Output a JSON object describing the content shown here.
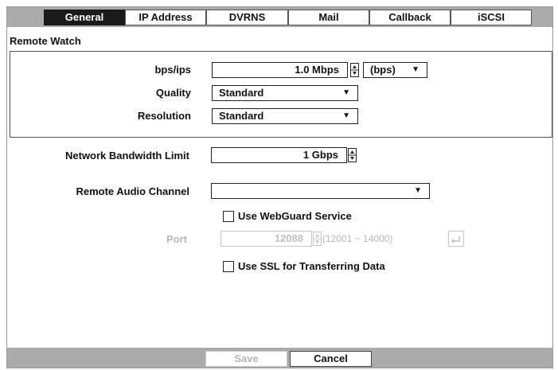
{
  "tabs": [
    "General",
    "IP Address",
    "DVRNS",
    "Mail",
    "Callback",
    "iSCSI"
  ],
  "active_tab": "General",
  "remote_watch": {
    "title": "Remote Watch",
    "bps_label": "bps/ips",
    "bps_value": "1.0 Mbps",
    "unit_value": "(bps)",
    "quality_label": "Quality",
    "quality_value": "Standard",
    "resolution_label": "Resolution",
    "resolution_value": "Standard"
  },
  "network_bandwidth": {
    "label": "Network Bandwidth Limit",
    "value": "1 Gbps"
  },
  "remote_audio": {
    "label": "Remote Audio Channel",
    "value": ""
  },
  "webguard": {
    "label": "Use WebGuard Service",
    "checked": false,
    "port_label": "Port",
    "port_value": "12088",
    "port_range": "(12001 ~ 14000)"
  },
  "ssl": {
    "label": "Use SSL for Transferring Data",
    "checked": false
  },
  "buttons": {
    "save": "Save",
    "cancel": "Cancel"
  },
  "icons": {
    "spin": "spin-arrows-icon",
    "dropdown": "dropdown-caret-icon",
    "reset": "reset-arrow-icon"
  }
}
